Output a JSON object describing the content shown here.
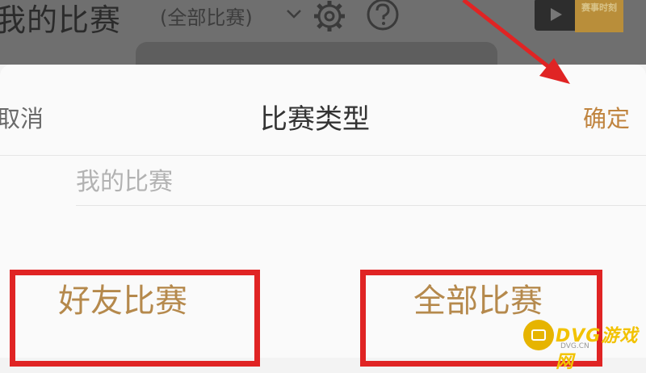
{
  "header": {
    "title": "我的比赛",
    "filter_label": "(全部比赛)",
    "promo_badge_text": "赛事时刻"
  },
  "sheet": {
    "cancel_label": "取消",
    "title": "比赛类型",
    "confirm_label": "确定",
    "section_label": "我的比赛",
    "options": [
      {
        "label": "好友比赛"
      },
      {
        "label": "全部比赛"
      }
    ]
  },
  "annotations": {
    "highlight_color": "#e02424",
    "arrow_color": "#e02424",
    "accent_color": "#c0843f"
  },
  "watermark": {
    "text": "DVG游戏网",
    "sub": "DVG.CN"
  },
  "icons": [
    "chevron-down-icon",
    "gear-icon",
    "help-icon",
    "play-icon"
  ]
}
